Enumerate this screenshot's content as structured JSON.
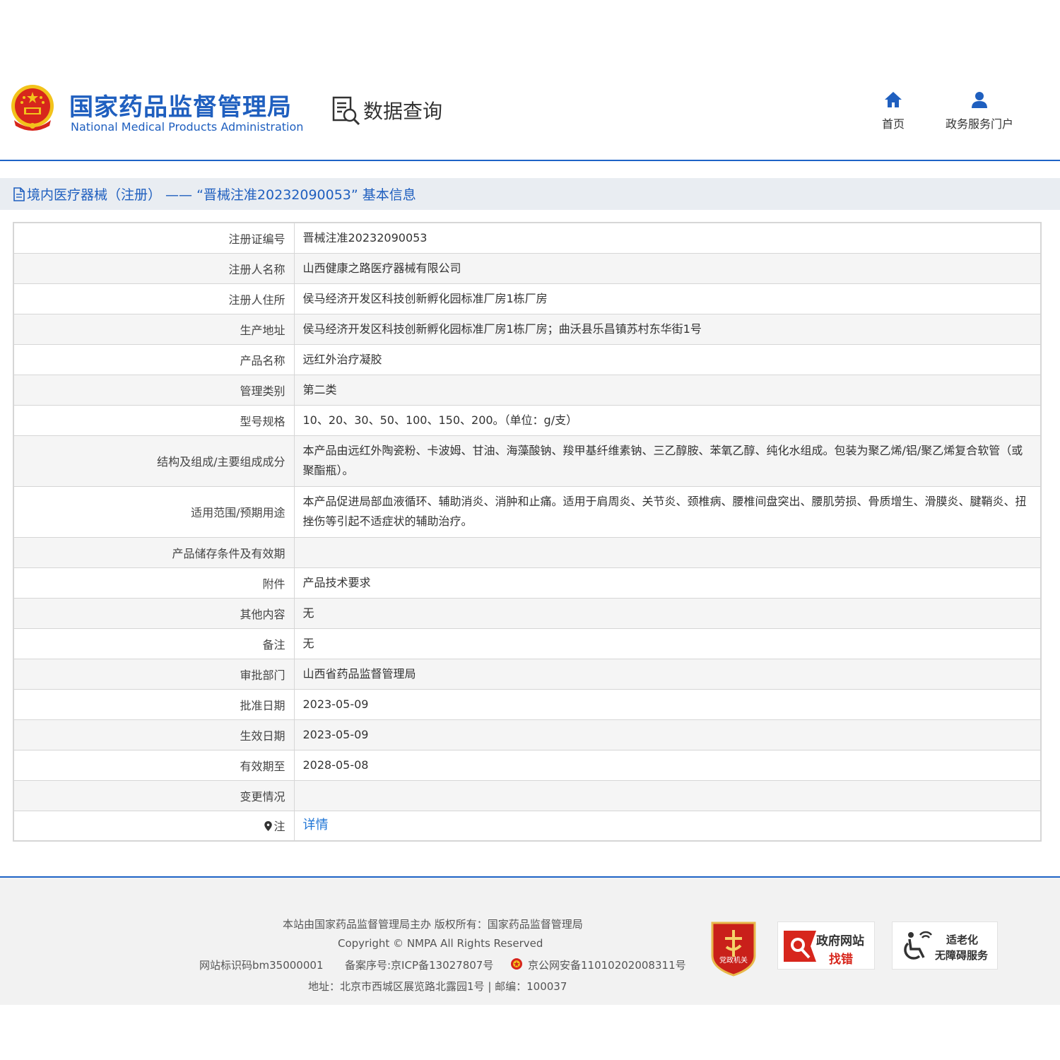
{
  "header": {
    "agency_cn": "国家药品监督管理局",
    "agency_en": "National Medical Products Administration",
    "query_label": "数据查询",
    "nav": [
      {
        "label": "首页",
        "icon": "home-icon"
      },
      {
        "label": "政务服务门户",
        "icon": "user-icon"
      }
    ]
  },
  "breadcrumb": {
    "text": "境内医疗器械（注册） —— “晋械注准20232090053” 基本信息",
    "icon": "document-icon"
  },
  "table": {
    "rows": [
      {
        "label": "注册证编号",
        "value": "晋械注准20232090053"
      },
      {
        "label": "注册人名称",
        "value": "山西健康之路医疗器械有限公司"
      },
      {
        "label": "注册人住所",
        "value": "侯马经济开发区科技创新孵化园标准厂房1栋厂房"
      },
      {
        "label": "生产地址",
        "value": "侯马经济开发区科技创新孵化园标准厂房1栋厂房；曲沃县乐昌镇苏村东华街1号"
      },
      {
        "label": "产品名称",
        "value": "远红外治疗凝胶"
      },
      {
        "label": "管理类别",
        "value": "第二类"
      },
      {
        "label": "型号规格",
        "value": "10、20、30、50、100、150、200。（单位：g/支）"
      },
      {
        "label": "结构及组成/主要组成成分",
        "value": "本产品由远红外陶瓷粉、卡波姆、甘油、海藻酸钠、羧甲基纤维素钠、三乙醇胺、苯氧乙醇、纯化水组成。包装为聚乙烯/铝/聚乙烯复合软管（或聚酯瓶）。"
      },
      {
        "label": "适用范围/预期用途",
        "value": "本产品促进局部血液循环、辅助消炎、消肿和止痛。适用于肩周炎、关节炎、颈椎病、腰椎间盘突出、腰肌劳损、骨质增生、滑膜炎、腱鞘炎、扭挫伤等引起不适症状的辅助治疗。"
      },
      {
        "label": "产品储存条件及有效期",
        "value": ""
      },
      {
        "label": "附件",
        "value": "产品技术要求"
      },
      {
        "label": "其他内容",
        "value": "无"
      },
      {
        "label": "备注",
        "value": "无"
      },
      {
        "label": "审批部门",
        "value": "山西省药品监督管理局"
      },
      {
        "label": "批准日期",
        "value": "2023-05-09"
      },
      {
        "label": "生效日期",
        "value": "2023-05-09"
      },
      {
        "label": "有效期至",
        "value": "2028-05-08"
      },
      {
        "label": "变更情况",
        "value": ""
      }
    ],
    "note_label": "注",
    "note_link": "详情"
  },
  "footer": {
    "line1": "本站由国家药品监督管理局主办 版权所有：国家药品监督管理局",
    "line2": "Copyright © NMPA All Rights Reserved",
    "site_code": "网站标识码bm35000001",
    "icp": "备案序号:京ICP备13027807号",
    "police": "京公网安备11010202008311号",
    "address": "地址：北京市西城区展览路北露园1号 | 邮编：100037",
    "badge_party": "党政机关",
    "badge_error_line1": "政府网站",
    "badge_error_line2": "找错",
    "badge_aging_line1": "适老化",
    "badge_aging_line2": "无障碍服务"
  },
  "colors": {
    "brand_blue": "#1f5fbf",
    "link_blue": "#1f75d6",
    "emblem_red": "#d7261c",
    "emblem_gold": "#f2c31b"
  }
}
